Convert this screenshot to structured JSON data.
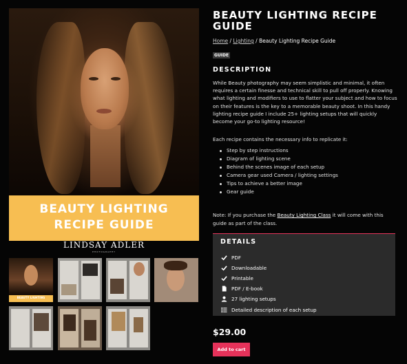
{
  "product": {
    "title": "BEAUTY LIGHTING RECIPE GUIDE",
    "category_tag": "GUIDE",
    "price": "$29.00",
    "add_to_cart": "Add to cart"
  },
  "breadcrumb": {
    "home": "Home",
    "sep1": " / ",
    "lighting": "Lighting",
    "sep2": " / ",
    "current": "Beauty Lighting Recipe Guide"
  },
  "cover": {
    "banner_line1": "BEAUTY LIGHTING",
    "banner_line2": "RECIPE GUIDE",
    "brand": "LINDSAY ADLER",
    "brand_sub": "PHOTOGRAPHY"
  },
  "thumbnails": {
    "first_banner": "BEAUTY LIGHTING"
  },
  "description": {
    "heading": "DESCRIPTION",
    "body": "While Beauty photography may seem simplistic and minimal, it often requires a certain finesse and technical skill to pull off properly. Knowing what lighting and modifiers to use to flatter your subject and how to focus on their features is the key to a memorable beauty shoot. In this handy lighting recipe guide I include 25+ lighting setups that will quickly become your go-to lighting resource!",
    "subheading": "Each recipe contains the necessary info to replicate it:",
    "bullets": [
      "Step by step instructions",
      "Diagram of lighting scene",
      "Behind the scenes image of each setup",
      "Camera gear used Camera / lighting settings",
      "Tips to achieve a better image",
      "Gear guide"
    ],
    "note_prefix": "Note: If you purchase the ",
    "note_link": "Beauty Lighting Class",
    "note_suffix": " it will come with this guide as part of the class."
  },
  "details": {
    "heading": "DETAILS",
    "items": [
      {
        "icon": "check-icon",
        "label": "PDF"
      },
      {
        "icon": "check-icon",
        "label": "Downloadable"
      },
      {
        "icon": "check-icon",
        "label": "Printable"
      },
      {
        "icon": "file-icon",
        "label": "PDF / E-book"
      },
      {
        "icon": "user-icon",
        "label": "27 lighting setups"
      },
      {
        "icon": "list-icon",
        "label": "Detailed description of each setup"
      }
    ]
  },
  "colors": {
    "background": "#050505",
    "accent": "#e6325a",
    "banner": "#f7be52",
    "details_panel": "#2b2b2b"
  }
}
